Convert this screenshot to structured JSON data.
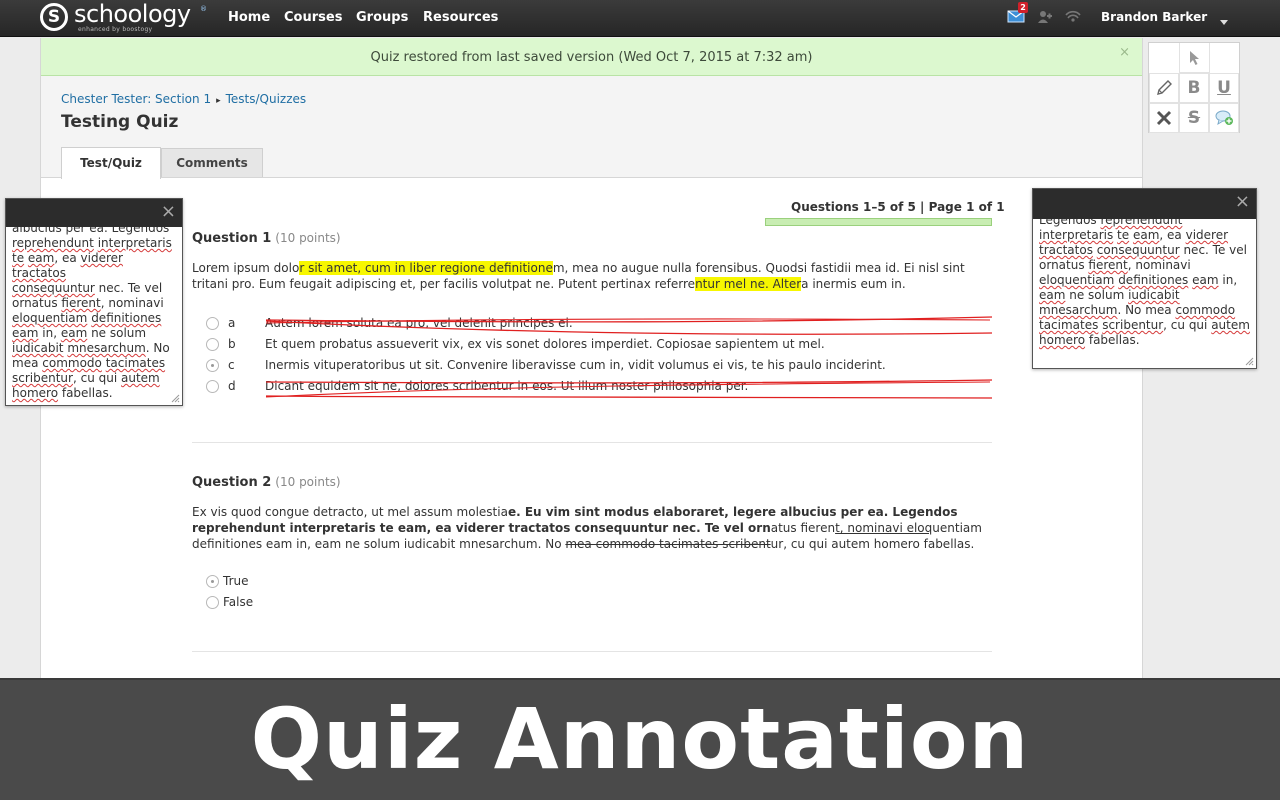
{
  "app": {
    "logo_letter": "S",
    "logo_name": "schoology",
    "logo_tm": "®",
    "logo_tagline": "enhanced by boostogy"
  },
  "nav": {
    "items": [
      "Home",
      "Courses",
      "Groups",
      "Resources"
    ],
    "message_count": "2",
    "user_name": "Brandon Barker"
  },
  "flash": {
    "message": "Quiz restored from last saved version (Wed Oct 7, 2015 at 7:32 am)",
    "close": "×"
  },
  "breadcrumb": {
    "course": "Chester Tester: Section 1",
    "separator": "▸",
    "section": "Tests/Quizzes"
  },
  "page_title": "Testing Quiz",
  "tabs": [
    "Test/Quiz",
    "Comments"
  ],
  "quiz": {
    "count_label": "Questions 1–5 of 5 | Page 1 of 1",
    "progress_fraction": 1.0
  },
  "question1": {
    "title": "Question 1",
    "points": "(10 points)",
    "body_1": "Lorem ipsum dolo",
    "body_hl1": "r sit amet, cum in liber regione definitione",
    "body_2": "m, mea no augue nulla forensibus. Quodsi fastidii mea id. Ei nisl sint tritani pro. Eum feugait adipiscing et, per facilis volutpat ne. Putent pertinax referre",
    "body_hl2": "ntur mel ne. Alter",
    "body_3": "a inermis eum in.",
    "choices": [
      {
        "letter": "a",
        "text": "Autem lorem soluta ea pro, vel delenit principes ei.",
        "selected": false,
        "crossed": true
      },
      {
        "letter": "b",
        "text": "Et quem probatus assueverit vix, ex vis sonet dolores imperdiet. Copiosae sapientem ut mel.",
        "selected": false,
        "crossed": false
      },
      {
        "letter": "c",
        "text": "Inermis vituperatoribus ut sit. Convenire liberavisse cum in, vidit volumus ei vis, te his paulo inciderint.",
        "selected": true,
        "crossed": false
      },
      {
        "letter": "d",
        "text": "Dicant equidem sit ne, dolores scribentur in eos. Ut illum noster philosophia per.",
        "selected": false,
        "crossed": true
      }
    ]
  },
  "question2": {
    "title": "Question 2",
    "points": "(10 points)",
    "p1": "Ex vis quod congue detracto, ut mel assum molestia",
    "p2": "e. Eu vim sint modus elaboraret, legere albucius per ea. Legendos reprehendunt interpretaris te eam, ea viderer tractatos consequuntur nec. Te vel orn",
    "p3": "atus fieren",
    "p4": "t, nominavi eloq",
    "p5": "uentiam definitiones eam in, eam ne solum iudicabit mnesarchum. No ",
    "p6": "mea commodo tacimates scribent",
    "p7": "ur, cu qui autem homero fabellas.",
    "options": [
      {
        "label": "True",
        "selected": true
      },
      {
        "label": "False",
        "selected": false
      }
    ]
  },
  "note_left": {
    "close": "×",
    "l1": "albucius per ea. Legendos",
    "l2a": "reprehendunt",
    "l2b": " ",
    "l2c": "interpretaris",
    "l3a": "te",
    "l3b": " ",
    "l3c": "eam",
    "l3d": ", ea ",
    "l3e": "viderer",
    "l3f": " ",
    "l3g": "tractatos",
    "l4a": "consequuntur",
    "l4b": " nec. Te vel",
    "l5a": "ornatus ",
    "l5b": "fierent",
    "l5c": ", nominavi",
    "l6a": "eloquentiam",
    "l6b": " ",
    "l6c": "definitiones",
    "l7a": "eam",
    "l7b": " in, ",
    "l7c": "eam",
    "l7d": " ne solum",
    "l8a": "iudicabit",
    "l8b": " ",
    "l8c": "mnesarchum",
    "l8d": ". No",
    "l9a": "mea ",
    "l9b": "commodo",
    "l9c": " ",
    "l9d": "tacimates",
    "l10a": "scribentur",
    "l10b": ", cu qui ",
    "l10c": "autem",
    "l11a": "homero",
    "l11b": " fabellas."
  },
  "note_right": {
    "close": "×",
    "l1a": "Legendos ",
    "l1b": "reprehendunt",
    "l2a": "interpretaris",
    "l2b": " ",
    "l2c": "te",
    "l2d": " ",
    "l2e": "eam",
    "l2f": ", ea ",
    "l2g": "viderer",
    "l3a": "tractatos",
    "l3b": " ",
    "l3c": "consequuntur",
    "l3d": " nec. Te vel",
    "l4a": "ornatus ",
    "l4b": "fierent",
    "l4c": ", nominavi",
    "l5a": "eloquentiam",
    "l5b": " ",
    "l5c": "definitiones",
    "l5d": " ",
    "l5e": "eam",
    "l5f": " in,",
    "l6a": "eam",
    "l6b": " ne solum ",
    "l6c": "iudicabit",
    "l7a": "mnesarchum",
    "l7b": ". No mea ",
    "l7c": "commodo",
    "l8a": "tacimates",
    "l8b": " ",
    "l8c": "scribentur",
    "l8d": ", cu qui ",
    "l8e": "autem",
    "l9a": "homero",
    "l9b": " fabellas."
  },
  "toolbar": {
    "bold": "B",
    "underline": "U",
    "strike": "S"
  },
  "banner": {
    "text": "Quiz Annotation"
  },
  "colors": {
    "highlight": "#f7f700",
    "flash_bg": "#dcf8cf",
    "link": "#1f6ea3",
    "annotation_red": "#e02020",
    "topbar": "#2e2e2e",
    "banner_bg": "#4a4a4a"
  }
}
